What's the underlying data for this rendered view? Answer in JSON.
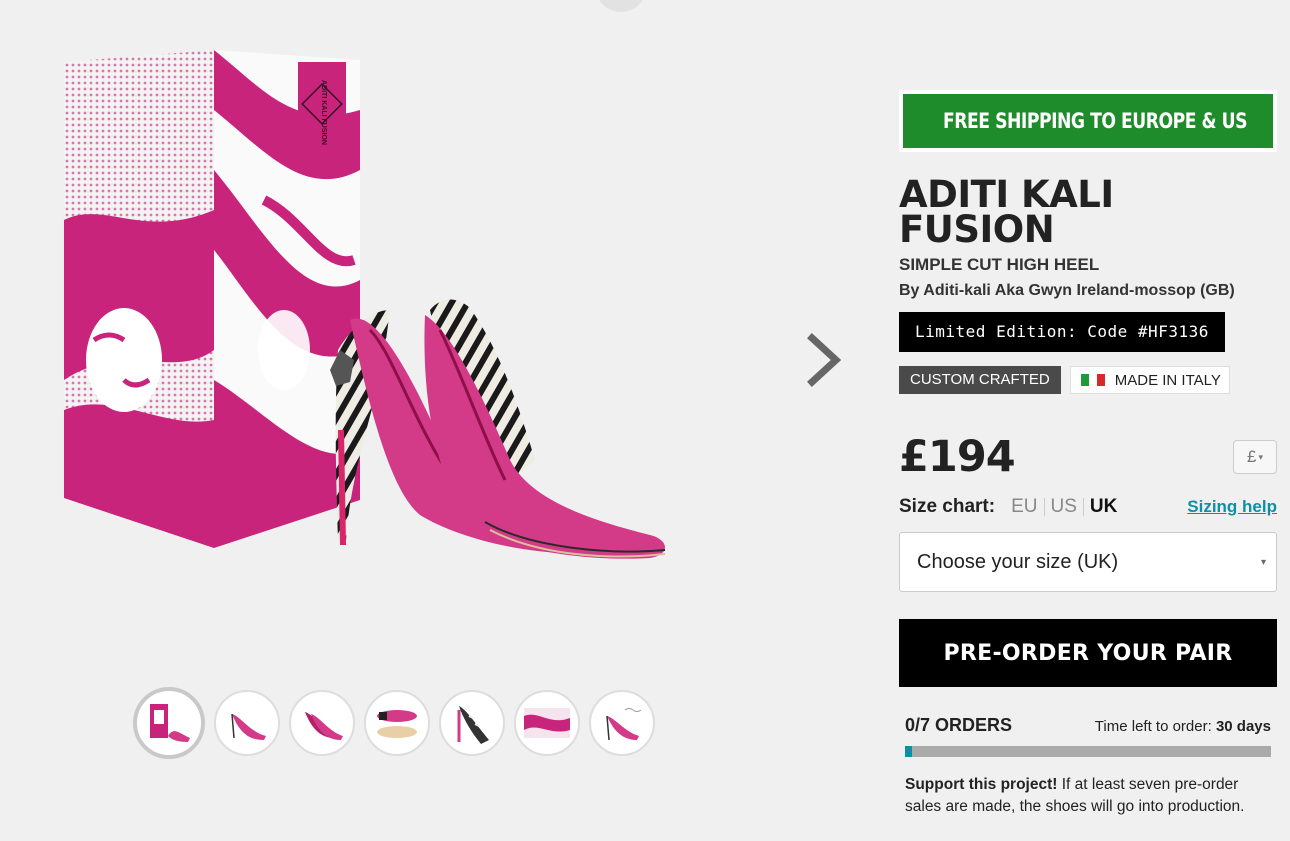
{
  "shipping": {
    "label": "FREE SHIPPING TO EUROPE & US"
  },
  "product": {
    "title": "ADITI KALI FUSION",
    "subtitle": "SIMPLE CUT HIGH HEEL",
    "byline": "By Aditi-kali Aka Gwyn Ireland-mossop (GB)",
    "limited_edition": "Limited Edition: Code #HF3136",
    "box_brand": "ADITI KALI FUSION"
  },
  "badges": {
    "custom": "CUSTOM CRAFTED",
    "made_in": "MADE IN ITALY"
  },
  "price": {
    "amount": "£194",
    "currency_button": "£"
  },
  "size_chart": {
    "label": "Size chart:",
    "options": [
      "EU",
      "US",
      "UK"
    ],
    "selected": "UK",
    "help_link": "Sizing help"
  },
  "size_select": {
    "placeholder": "Choose your size (UK)"
  },
  "cta": {
    "label": "PRE-ORDER YOUR PAIR"
  },
  "orders": {
    "count": "0/7 ORDERS",
    "time_prefix": "Time left to order: ",
    "time_value": "30 days",
    "progress": 0.02
  },
  "support": {
    "bold": "Support this project!",
    "text": " If at least seven pre-order sales are made, the shoes will go into production."
  },
  "thumbnails": [
    {
      "name": "thumb-box-and-pair",
      "active": true
    },
    {
      "name": "thumb-side-view",
      "active": false
    },
    {
      "name": "thumb-pair-front",
      "active": false
    },
    {
      "name": "thumb-top-view",
      "active": false
    },
    {
      "name": "thumb-heel-detail",
      "active": false
    },
    {
      "name": "thumb-box",
      "active": false
    },
    {
      "name": "thumb-side-signed",
      "active": false
    }
  ],
  "colors": {
    "shipping_green": "#1f8c2b",
    "accent_teal": "#0f8fa5",
    "magenta": "#c8247b",
    "cta_black": "#000000"
  }
}
